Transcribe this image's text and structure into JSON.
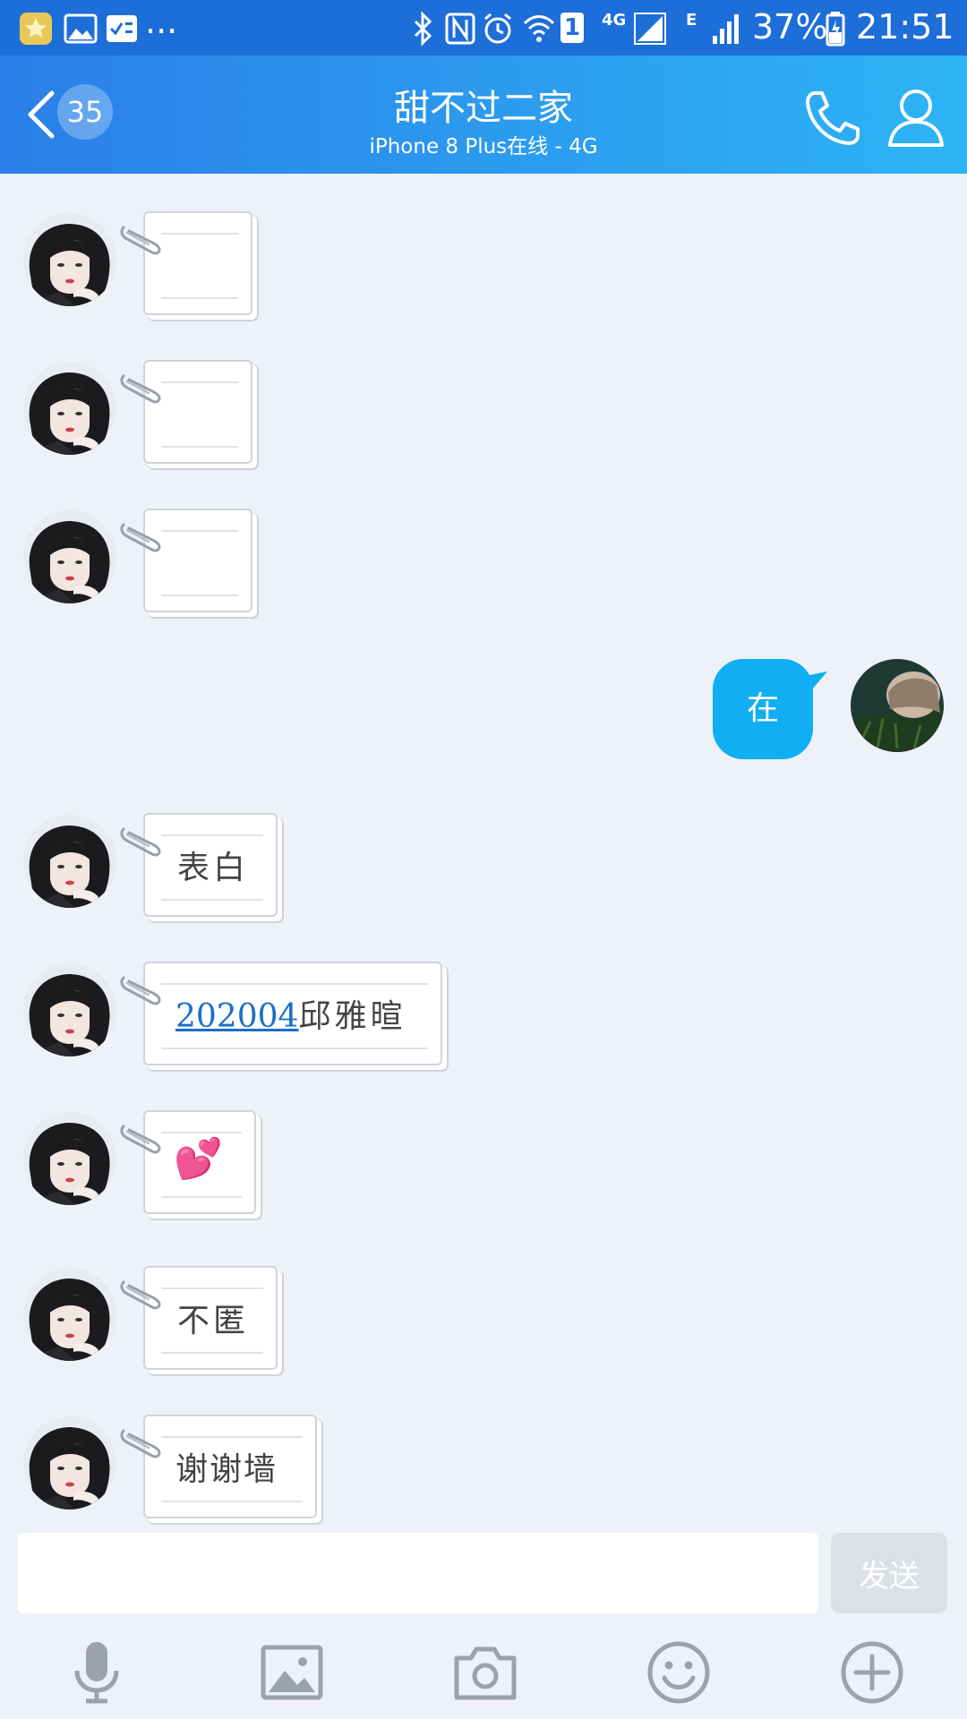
{
  "status_bar": {
    "time": "21:51",
    "battery": "37%",
    "sim_badge": "1",
    "network_4g": "4G",
    "network_e": "E",
    "overflow": "...",
    "icons": [
      "star-app-icon",
      "gallery-icon",
      "notes-app-icon",
      "bluetooth-icon",
      "nfc-icon",
      "alarm-icon",
      "wifi-icon",
      "signal-icon",
      "battery-icon"
    ]
  },
  "header": {
    "unread_count": "35",
    "title": "甜不过二家",
    "subtitle": "iPhone 8 Plus在线 - 4G"
  },
  "messages": [
    {
      "from": "other",
      "text": ""
    },
    {
      "from": "other",
      "text": ""
    },
    {
      "from": "other",
      "text": ""
    },
    {
      "from": "self",
      "text": "在"
    },
    {
      "from": "other",
      "text": "表白"
    },
    {
      "from": "other",
      "link": "202004",
      "text": "邱雅暄"
    },
    {
      "from": "other",
      "emoji": "💕"
    },
    {
      "from": "other",
      "text": "不匿"
    },
    {
      "from": "other",
      "text": "谢谢墙"
    }
  ],
  "composer": {
    "placeholder": "",
    "send_label": "发送"
  },
  "toolbar": [
    "microphone-icon",
    "image-icon",
    "camera-icon",
    "emoji-icon",
    "plus-icon"
  ],
  "colors": {
    "header_start": "#2a7fe8",
    "header_end": "#2db4f5",
    "self_bubble": "#10aef2",
    "background": "#eef2f8",
    "link": "#1a6fc7"
  }
}
